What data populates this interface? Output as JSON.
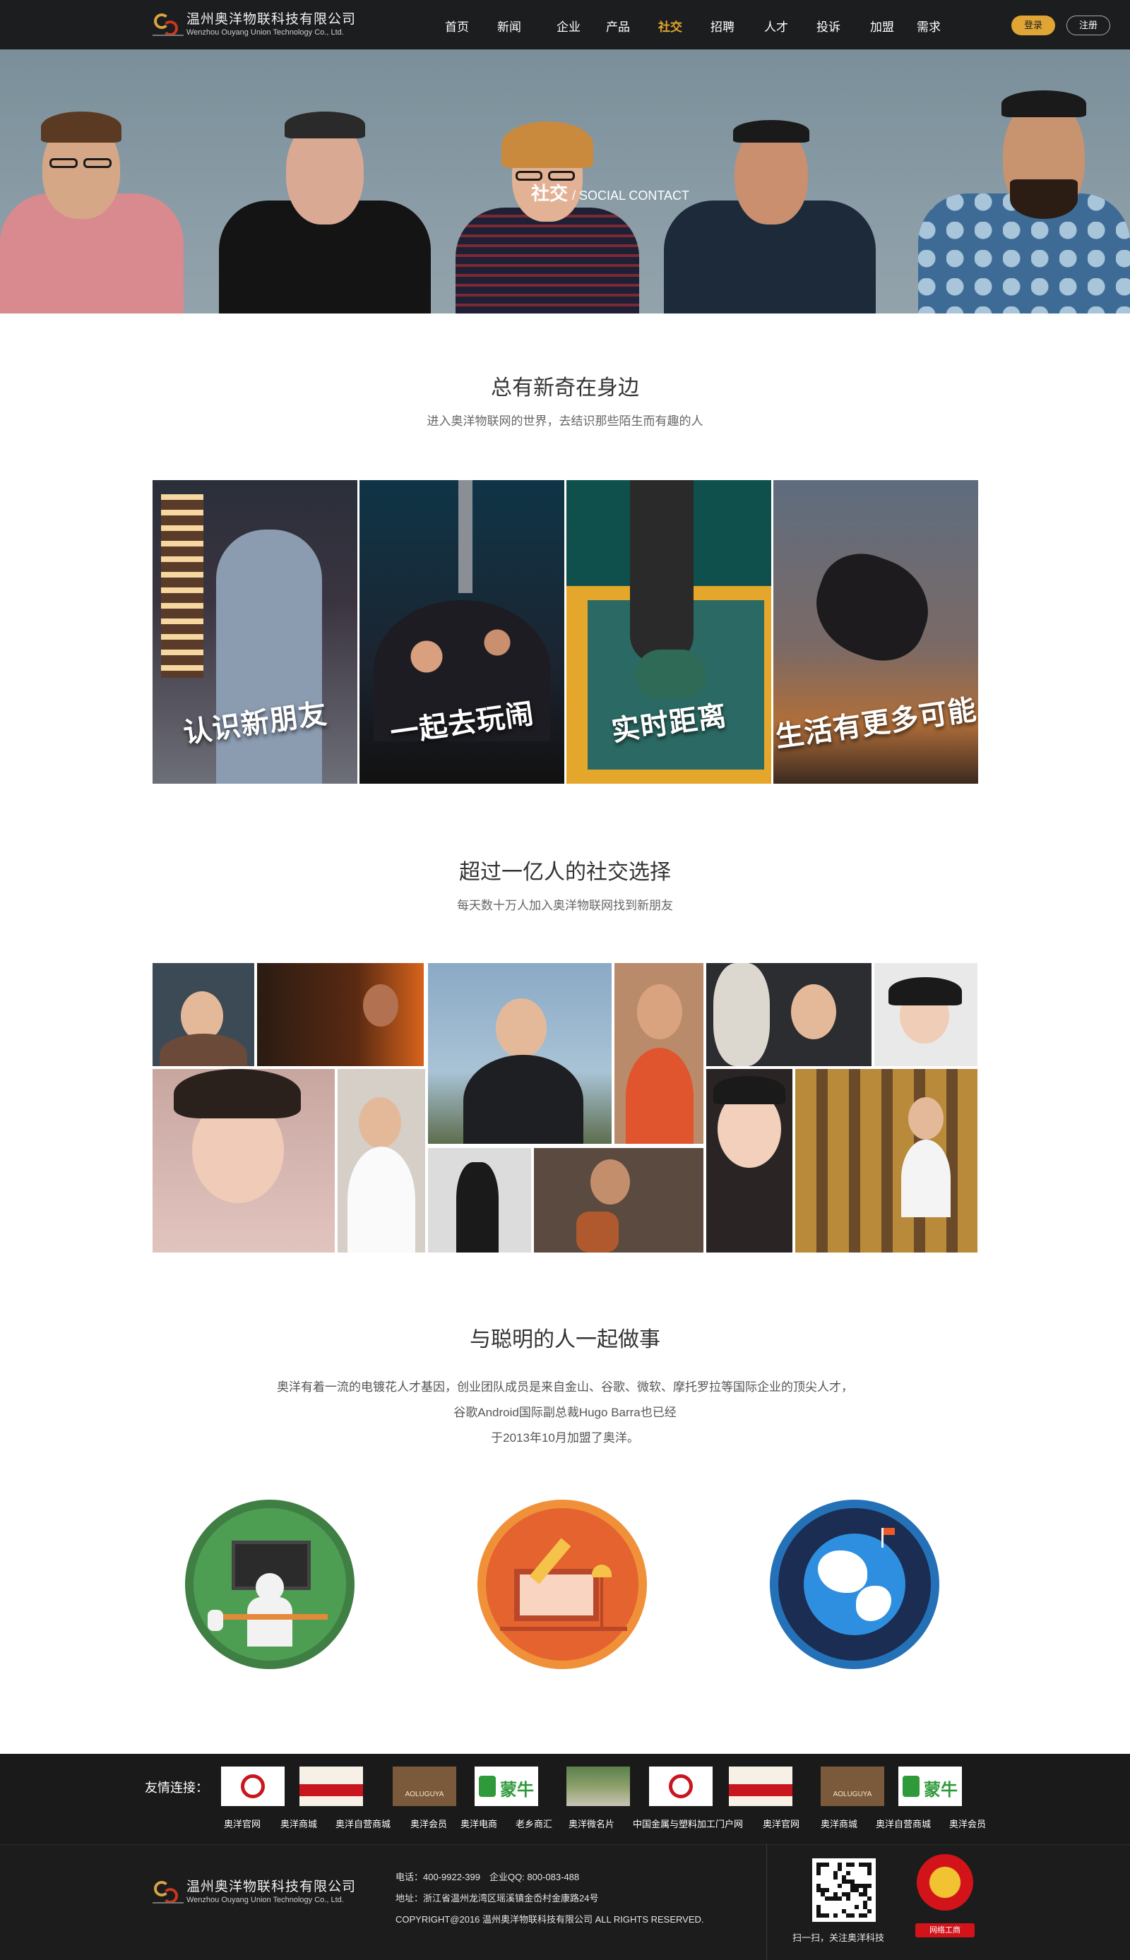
{
  "header": {
    "logo_cn": "温州奥洋物联科技有限公司",
    "logo_en": "Wenzhou Ouyang Union Technology Co., Ltd.",
    "nav": [
      "首页",
      "新闻",
      "企业",
      "产品",
      "社交",
      "招聘",
      "人才",
      "投诉",
      "加盟",
      "需求"
    ],
    "active_nav": "社交",
    "login_label": "登录",
    "register_label": "注册",
    "accent_color": "#e1a535"
  },
  "hero": {
    "title_cn": "社交",
    "title_en": "/ SOCIAL CONTACT"
  },
  "section1": {
    "title": "总有新奇在身边",
    "subtitle": "进入奥洋物联网的世界，去结识那些陌生而有趣的人",
    "tiles": [
      "认识新朋友",
      "一起去玩闹",
      "实时距离",
      "生活有更多可能"
    ]
  },
  "section2": {
    "title": "超过一亿人的社交选择",
    "subtitle": "每天数十万人加入奥洋物联网找到新朋友"
  },
  "section3": {
    "title": "与聪明的人一起做事",
    "lines": [
      "奥洋有着一流的电镀花人才基因，创业团队成员是来自金山、谷歌、微软、摩托罗拉等国际企业的顶尖人才，",
      "谷歌Android国际副总裁Hugo Barra也已经",
      "于2013年10月加盟了奥洋。"
    ]
  },
  "friend_links": {
    "label": "友情连接：",
    "links": [
      "奥洋官网",
      "奥洋商城",
      "奥洋自营商城",
      "奥洋会员",
      "奥洋电商",
      "老乡商汇",
      "奥洋微名片",
      "中国金属与塑料加工门户网",
      "奥洋官网",
      "奥洋商城",
      "奥洋自营商城",
      "奥洋会员"
    ],
    "logos": [
      "red-seal-logo",
      "banner-logo",
      "aoluguya-logo",
      "mengniu-logo",
      "gate-photo-logo",
      "red-seal-logo",
      "banner-logo",
      "aoluguya-logo",
      "mengniu-logo"
    ],
    "aoluguya_text": "AOLUGUYA",
    "mengniu_text": "蒙牛"
  },
  "footer": {
    "company_cn": "温州奥洋物联科技有限公司",
    "company_en": "Wenzhou Ouyang Union Technology Co., Ltd.",
    "phone": "电话：400-9922-399　企业QQ: 800-083-488",
    "address": "地址：浙江省温州龙湾区瑶溪镇金岙村金康路24号",
    "copyright": "COPYRIGHT@2016 温州奥洋物联科技有限公司 ALL RIGHTS RESERVED.",
    "qr_caption": "扫一扫，关注奥洋科技",
    "badge_label": "网络工商"
  }
}
